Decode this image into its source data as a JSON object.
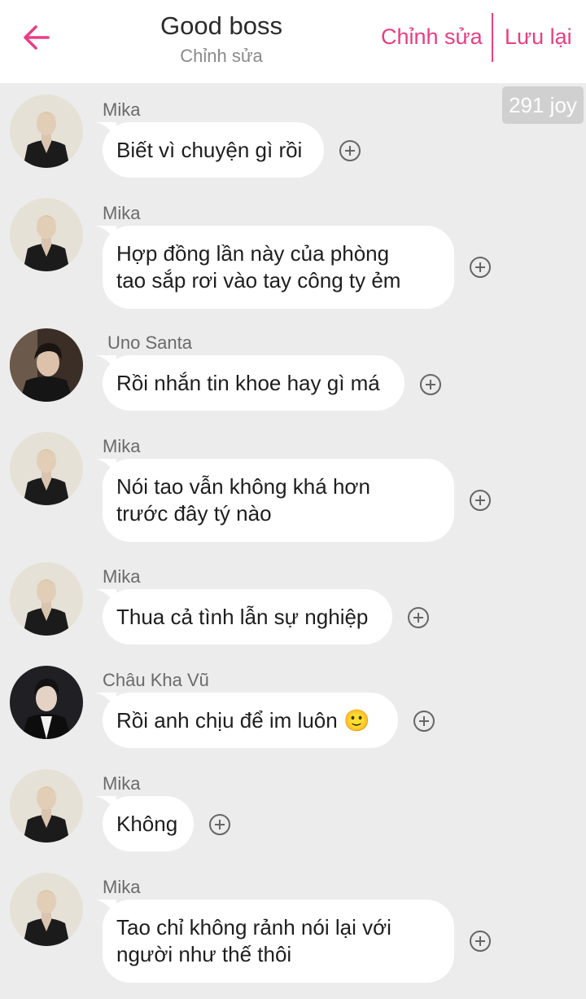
{
  "header": {
    "title": "Good boss",
    "subtitle": "Chỉnh sửa",
    "edit_label": "Chỉnh sửa",
    "save_label": "Lưu lại",
    "accent_color": "#e83e84"
  },
  "badge": {
    "text": "291 joy"
  },
  "messages": [
    {
      "sender": "Mika",
      "text": "Biết vì chuyện gì rồi",
      "avatar": "mika-avatar"
    },
    {
      "sender": "Mika",
      "text": "Hợp đồng lần này của phòng\ntao sắp rơi vào tay công ty ẻm",
      "avatar": "mika-avatar"
    },
    {
      "sender": "Uno Santa",
      "text": "Rồi nhắn tin khoe hay gì má",
      "avatar": "uno-santa-avatar"
    },
    {
      "sender": "Mika",
      "text": "Nói tao vẫn không khá hơn\ntrước đây tý nào",
      "avatar": "mika-avatar"
    },
    {
      "sender": "Mika",
      "text": "Thua cả tình lẫn sự nghiệp",
      "avatar": "mika-avatar"
    },
    {
      "sender": "Châu Kha Vũ",
      "text": "Rồi anh chịu để im luôn 🙂",
      "avatar": "chau-kha-vu-avatar"
    },
    {
      "sender": "Mika",
      "text": "Không",
      "avatar": "mika-avatar"
    },
    {
      "sender": "Mika",
      "text": "Tao chỉ không rảnh nói lại với\nngười như thế thôi",
      "avatar": "mika-avatar"
    }
  ]
}
